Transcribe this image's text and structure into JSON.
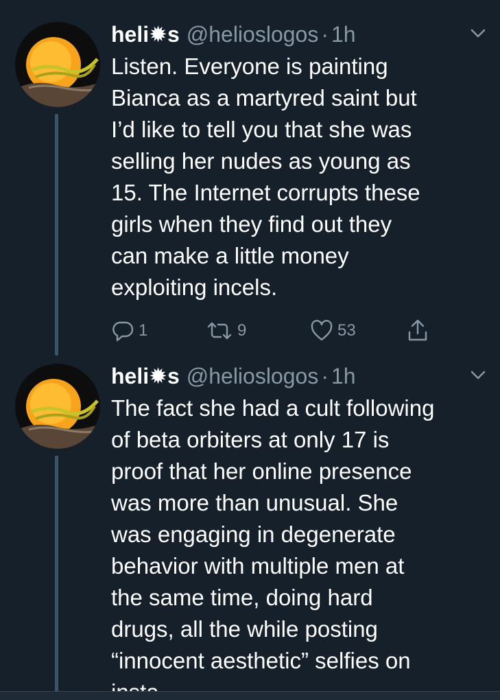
{
  "tweets": [
    {
      "display_name": "heli✹s",
      "handle": "@helioslogos",
      "dot": "·",
      "time": "1h",
      "text": "Listen. Everyone is painting\nBianca as a martyred saint but\nI’d like to tell you that she was\nselling her nudes as young as\n15. The Internet corrupts these\ngirls when they find out they\ncan make a little money\nexploiting incels.",
      "replies": "1",
      "retweets": "9",
      "likes": "53",
      "icons": [
        "reply-icon",
        "retweet-icon",
        "like-icon",
        "share-icon",
        "chevron-down-icon"
      ]
    },
    {
      "display_name": "heli✹s",
      "handle": "@helioslogos",
      "dot": "·",
      "time": "1h",
      "text": "The fact she had a cult following\nof beta orbiters at only 17 is\nproof that her online presence\nwas more than unusual. She\nwas engaging in degenerate\nbehavior with multiple men at\nthe same time, doing hard\ndrugs, all the while posting\n“innocent aesthetic” selfies on\ninsta",
      "icons": [
        "chevron-down-icon"
      ]
    }
  ],
  "colors": {
    "background": "#15202b",
    "text": "#ffffff",
    "secondary_text": "#8899a6",
    "thread_line": "#3d5466"
  }
}
